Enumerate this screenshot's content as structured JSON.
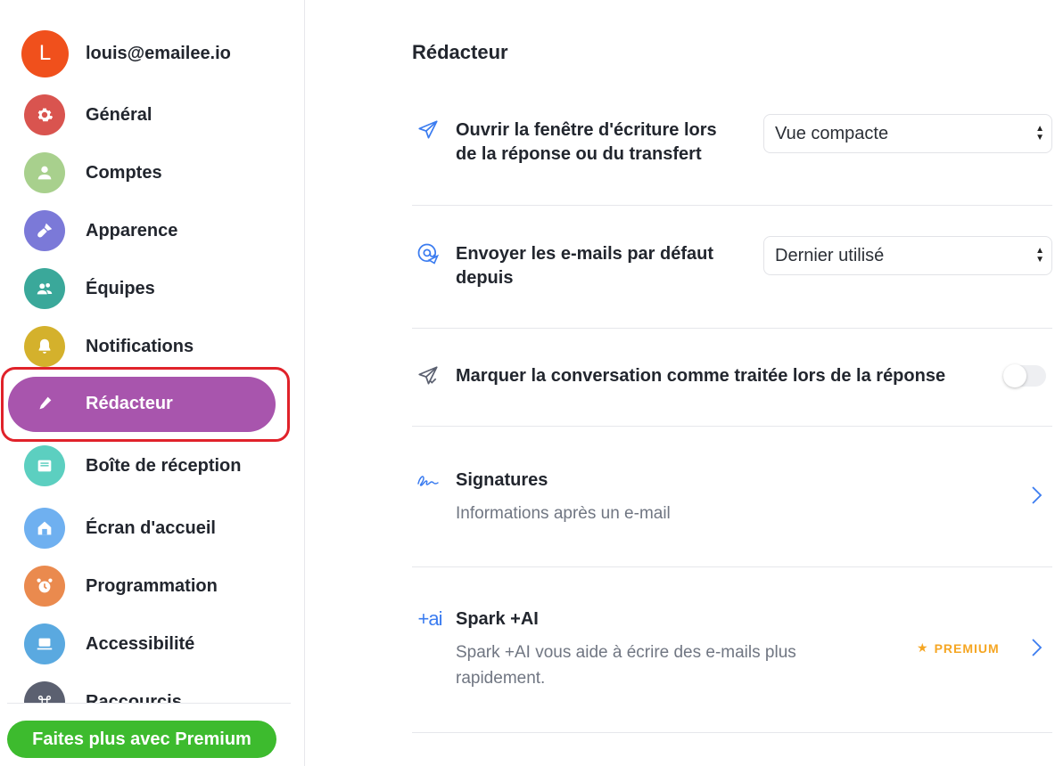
{
  "sidebar": {
    "user": {
      "initial": "L",
      "email": "louis@emailee.io",
      "avatar_color": "#f0501c"
    },
    "items": [
      {
        "label": "Général",
        "icon": "gear-icon",
        "color": "#d9544f"
      },
      {
        "label": "Comptes",
        "icon": "person-icon",
        "color": "#a8d08d"
      },
      {
        "label": "Apparence",
        "icon": "paintbrush-icon",
        "color": "#7b79d8"
      },
      {
        "label": "Équipes",
        "icon": "team-icon",
        "color": "#3aa89a"
      },
      {
        "label": "Notifications",
        "icon": "bell-icon",
        "color": "#d4b12c"
      },
      {
        "label": "Rédacteur",
        "icon": "pen-icon",
        "color": "#a855ad",
        "active": true
      },
      {
        "label": "Boîte de réception",
        "icon": "inbox-icon",
        "color": "#5ccfc0"
      },
      {
        "label": "Écran d'accueil",
        "icon": "home-icon",
        "color": "#6fb0f0"
      },
      {
        "label": "Programmation",
        "icon": "alarm-clock-icon",
        "color": "#ea8a4e"
      },
      {
        "label": "Accessibilité",
        "icon": "laptop-icon",
        "color": "#5aa9e0"
      },
      {
        "label": "Raccourcis",
        "icon": "command-icon",
        "color": "#5b6070"
      }
    ],
    "premium_button": "Faites plus avec Premium",
    "premium_color": "#3dbb2e"
  },
  "main": {
    "title": "Rédacteur",
    "settings": [
      {
        "label": "Ouvrir la fenêtre d'écriture lors de la réponse ou du transfert",
        "icon": "send-icon",
        "control": "select",
        "value": "Vue compacte"
      },
      {
        "label": "Envoyer les e-mails par défaut depuis",
        "icon": "at-send-icon",
        "control": "select",
        "value": "Dernier utilisé"
      },
      {
        "label": "Marquer la conversation comme traitée lors de la réponse",
        "icon": "send-check-icon",
        "control": "toggle",
        "on": false
      },
      {
        "label": "Signatures",
        "subtitle": "Informations après un e-mail",
        "icon": "signature-icon",
        "control": "chevron"
      },
      {
        "label": "Spark +AI",
        "subtitle": "Spark +AI vous aide à écrire des e-mails plus rapidement.",
        "icon_text": "+ai",
        "control": "chevron",
        "badge": "PREMIUM"
      }
    ],
    "accent": "#3b7cf0"
  }
}
